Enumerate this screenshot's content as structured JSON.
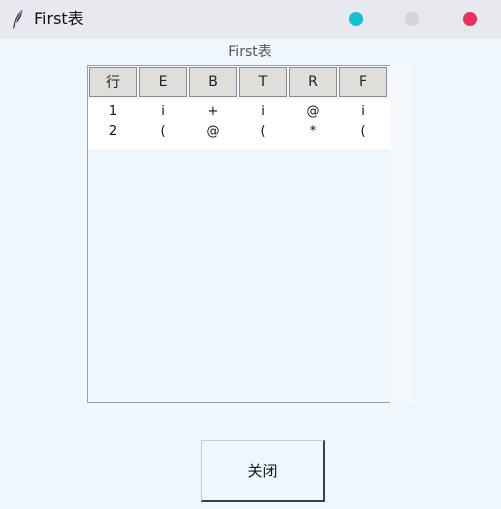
{
  "window": {
    "title": "First表",
    "icon": "feather-icon",
    "controls": {
      "minimize_color": "#17bfd0",
      "maximize_color": "#d4d4d4",
      "close_color": "#e8315d"
    }
  },
  "table": {
    "caption": "First表",
    "columns": [
      "行",
      "E",
      "B",
      "T",
      "R",
      "F"
    ],
    "rows": [
      [
        "1",
        "i",
        "+",
        "i",
        "@",
        "i"
      ],
      [
        "2",
        "(",
        "@",
        "(",
        "*",
        "("
      ]
    ]
  },
  "close_button": {
    "label": "关闭"
  }
}
